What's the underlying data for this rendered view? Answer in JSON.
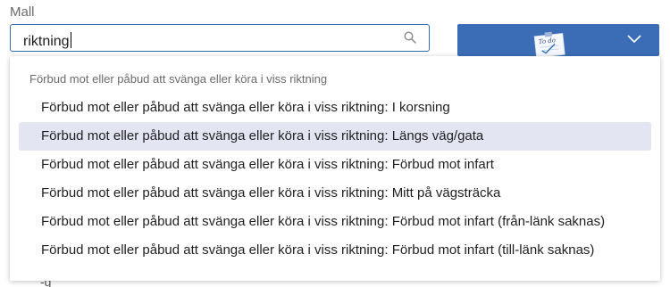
{
  "field": {
    "label": "Mall",
    "value": "riktning",
    "search_icon": "search-icon"
  },
  "action_button": {
    "icon": "todo-note-icon",
    "icon_text": "To do",
    "chevron": "chevron-down-icon",
    "color": "#3b6db6"
  },
  "dropdown": {
    "group_header": "Förbud mot eller påbud att svänga eller köra i viss riktning",
    "highlighted_index": 1,
    "highlight_color": "#e3e5f3",
    "options": [
      {
        "label": "Förbud mot eller påbud att svänga eller köra i viss riktning: I korsning"
      },
      {
        "label": "Förbud mot eller påbud att svänga eller köra i viss riktning: Längs väg/gata"
      },
      {
        "label": "Förbud mot eller påbud att svänga eller köra i viss riktning: Förbud mot infart"
      },
      {
        "label": "Förbud mot eller påbud att svänga eller köra i viss riktning: Mitt på vägsträcka"
      },
      {
        "label": "Förbud mot eller påbud att svänga eller köra i viss riktning: Förbud mot infart (från-länk saknas)"
      },
      {
        "label": "Förbud mot eller påbud att svänga eller köra i viss riktning: Förbud mot infart (till-länk saknas)"
      }
    ]
  }
}
